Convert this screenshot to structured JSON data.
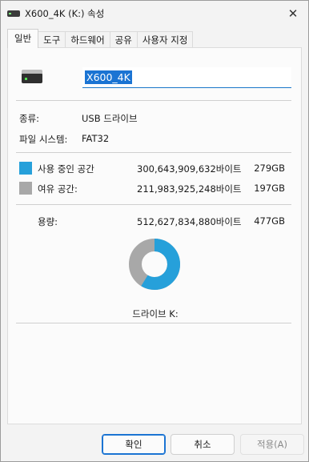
{
  "window": {
    "title": "X600_4K (K:) 속성",
    "close_glyph": "✕"
  },
  "tabs": [
    {
      "label": "일반",
      "active": true
    },
    {
      "label": "도구",
      "active": false
    },
    {
      "label": "하드웨어",
      "active": false
    },
    {
      "label": "공유",
      "active": false
    },
    {
      "label": "사용자 지정",
      "active": false
    }
  ],
  "general": {
    "drive_name": "X600_4K",
    "type_label": "종류:",
    "type_value": "USB 드라이브",
    "fs_label": "파일 시스템:",
    "fs_value": "FAT32",
    "used_label": "사용 중인 공간",
    "used_bytes": "300,643,909,632바이트",
    "used_gb": "279GB",
    "used_color": "#26a0da",
    "free_label": "여유 공간:",
    "free_bytes": "211,983,925,248바이트",
    "free_gb": "197GB",
    "free_color": "#a8a8a8",
    "capacity_label": "용량:",
    "capacity_bytes": "512,627,834,880바이트",
    "capacity_gb": "477GB",
    "used_fraction": 0.5865,
    "drive_caption": "드라이브 K:"
  },
  "buttons": {
    "ok": "확인",
    "cancel": "취소",
    "apply": "적용(A)"
  }
}
